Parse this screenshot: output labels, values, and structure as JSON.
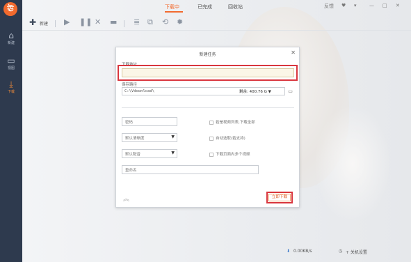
{
  "sidebar": {
    "logo": "ঊ",
    "items": [
      {
        "label": "新建",
        "icon": "home-icon"
      },
      {
        "label": "视图",
        "icon": "monitor-icon"
      },
      {
        "label": "下载",
        "icon": "download-icon"
      }
    ]
  },
  "tabs": [
    "下载中",
    "已完成",
    "回收站"
  ],
  "window": {
    "feedback": "反馈"
  },
  "toolbar": {
    "new_label": "新建"
  },
  "dialog": {
    "title": "新建任务",
    "url_label": "下载地址",
    "url_value": "",
    "path_label": "保存路径",
    "path_value": "C:\\Vdownload\\",
    "free_space": "剩余: 400.76 G",
    "password_placeholder": "密码",
    "quality_value": "默认清晰度",
    "audio_value": "默认配音",
    "rename_placeholder": "重命名",
    "options": [
      "若是视频列表,下载全部",
      "自动选取(若支持)",
      "下载页面内多个视频"
    ],
    "download_button": "立即下载"
  },
  "statusbar": {
    "speed": "0.00KB/s",
    "shutdown": "+ 关机设置"
  },
  "colors": {
    "accent": "#f26a2e",
    "highlight": "#d9363e",
    "sidebar": "#2e3a4e"
  }
}
